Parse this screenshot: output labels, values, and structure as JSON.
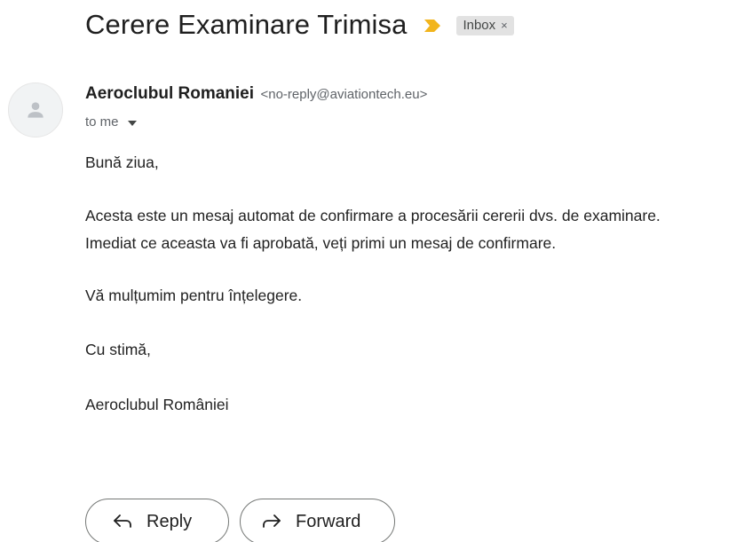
{
  "email": {
    "subject": "Cerere Examinare Trimisa",
    "label": "Inbox",
    "label_remove": "×",
    "sender_name": "Aeroclubul Romaniei",
    "sender_email": "<no-reply@aviationtech.eu>",
    "recipient": "to me",
    "body": {
      "greeting": "Bună ziua,",
      "line1": "Acesta este un mesaj automat de confirmare a procesării cererii dvs. de examinare.",
      "line2": "Imediat ce aceasta va fi aprobată, veți primi un mesaj de confirmare.",
      "thanks": "Vă mulțumim pentru înțelegere.",
      "closing": "Cu stimă,",
      "signature": "Aeroclubul României"
    }
  },
  "actions": {
    "reply_label": "Reply",
    "forward_label": "Forward"
  },
  "colors": {
    "importance_marker": "#f2b51d",
    "label_bg": "#e2e2e2"
  },
  "icons": {
    "importance": "importance-marker-icon",
    "avatar": "person-icon",
    "reply": "reply-arrow-icon",
    "forward": "forward-arrow-icon",
    "caret": "chevron-down-icon"
  }
}
